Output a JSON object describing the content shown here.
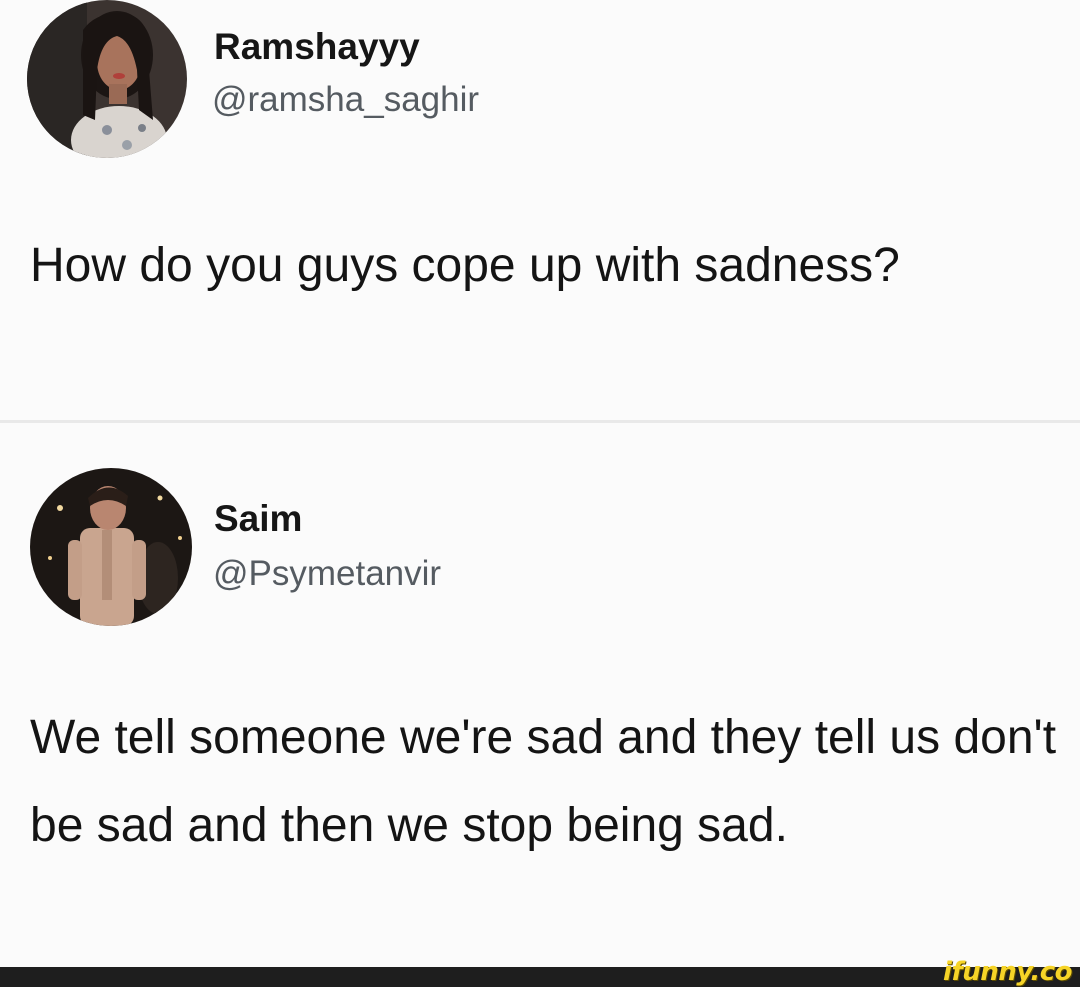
{
  "tweets": [
    {
      "display_name": "Ramshayyy",
      "handle": "@ramsha_saghir",
      "text": "How do you guys cope up with sadness?"
    },
    {
      "display_name": "Saim",
      "handle": "@Psymetanvir",
      "text": "We tell someone we're sad and they tell us don't be sad and then we stop being sad."
    }
  ],
  "watermark": "ifunny.co",
  "colors": {
    "background": "#fbfbfb",
    "text": "#141414",
    "handle": "#555b61",
    "divider": "#e9e9e9",
    "footer": "#1e1e1e",
    "watermark": "#f6d427"
  }
}
